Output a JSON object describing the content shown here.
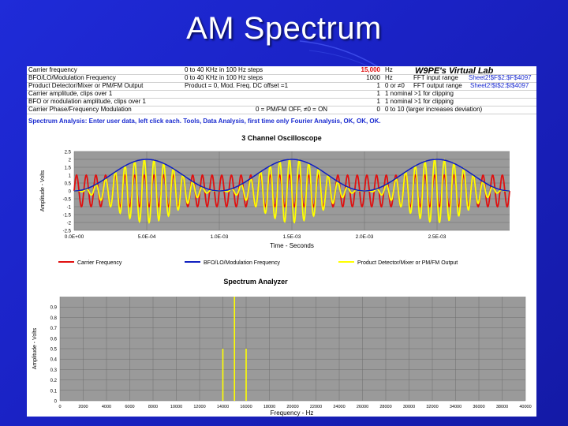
{
  "slide": {
    "title": "AM Spectrum"
  },
  "lab": {
    "name": "W9PE's Virtual Lab",
    "rows": [
      {
        "label": "Carrier frequency",
        "range": "0 to 40 KHz in 100 Hz steps",
        "value": "15,000",
        "unit": "Hz",
        "note_label": "FFT input range",
        "note_ref": "Sheet2!$F$2:$F$4097"
      },
      {
        "label": "BFO/LO/Modulation Frequency",
        "range": "0 to 40 KHz in 100 Hz steps",
        "value": "1000",
        "unit": "Hz",
        "note_label": "FFT output range",
        "note_ref": "Sheet2!$I$2:$I$4097"
      },
      {
        "label": "Product Detector/Mixer or PM/FM Output",
        "range": "Product = 0, Mod. Freq. DC offset =1",
        "value": "1",
        "unit": "0 or ≠0",
        "note_label": "1 nominal >1 for clipping",
        "note_ref": ""
      },
      {
        "label": "Carrier amplitude, clips over 1",
        "range": "",
        "value": "1",
        "unit": "1 nominal >1 for clipping",
        "note_label": "",
        "note_ref": ""
      },
      {
        "label": "BFO or modulation amplitude, clips over 1",
        "range": "",
        "value": "1",
        "unit": "1 nominal >1 for clipping",
        "note_label": "",
        "note_ref": ""
      },
      {
        "label": "Carrier Phase/Frequency Modulation",
        "range": "0 = PM/FM OFF, ≠0 = ON",
        "value": "0",
        "unit": "0 to 10 (larger increases deviation)",
        "note_label": "",
        "note_ref": ""
      }
    ],
    "instruction": "Spectrum Analysis: Enter user data, left click each. Tools, Data Analysis, first time only Fourier Analysis, OK, OK, OK."
  },
  "colors": {
    "carrier": "#e01010",
    "bfo": "#1020c0",
    "product": "#ffff00",
    "plot_bg": "#9a9a9a",
    "grid": "#6e6e6e"
  },
  "chart_data": [
    {
      "type": "line",
      "title": "3 Channel Oscilloscope",
      "xlabel": "Time - Seconds",
      "ylabel": "Amplitude - Volts",
      "xlim": [
        0,
        0.003
      ],
      "ylim": [
        -2.5,
        2.5
      ],
      "x_ticks": [
        "0.0E+00",
        "5.0E-04",
        "1.0E-03",
        "1.5E-03",
        "2.0E-03",
        "2.5E-03"
      ],
      "y_ticks": [
        "2.5",
        "2",
        "1.5",
        "1",
        "0.5",
        "0",
        "-0.5",
        "-1",
        "-1.5",
        "-2",
        "-2.5"
      ],
      "grid": true,
      "legend_position": "bottom",
      "series": [
        {
          "name": "Carrier Frequency",
          "color": "#e01010",
          "frequency_hz": 15000,
          "amplitude": 1,
          "dc_offset": 0
        },
        {
          "name": "BFO/LO/Modulation Frequency",
          "color": "#1020c0",
          "frequency_hz": 1000,
          "amplitude": 1,
          "dc_offset": 1
        },
        {
          "name": "Product Detector/Mixer or PM/FM Output",
          "color": "#ffff00",
          "carrier_hz": 15000,
          "modulation_hz": 1000
        }
      ]
    },
    {
      "type": "line",
      "title": "Spectrum Analyzer",
      "xlabel": "Frequency - Hz",
      "ylabel": "Amplitude - Volts",
      "xlim": [
        0,
        40000
      ],
      "ylim": [
        0,
        1
      ],
      "x_ticks": [
        "0",
        "2000",
        "4000",
        "6000",
        "8000",
        "10000",
        "12000",
        "14000",
        "16000",
        "18000",
        "20000",
        "22000",
        "24000",
        "26000",
        "28000",
        "30000",
        "32000",
        "34000",
        "36000",
        "38000",
        "40000"
      ],
      "y_ticks": [
        "0.9",
        "0.8",
        "0.7",
        "0.6",
        "0.5",
        "0.4",
        "0.3",
        "0.2",
        "0.1",
        "0"
      ],
      "grid": true,
      "series": [
        {
          "name": "Spectrum",
          "color": "#ffff00",
          "x": [
            14000,
            15000,
            16000
          ],
          "y": [
            0.5,
            1.0,
            0.5
          ]
        }
      ]
    }
  ]
}
